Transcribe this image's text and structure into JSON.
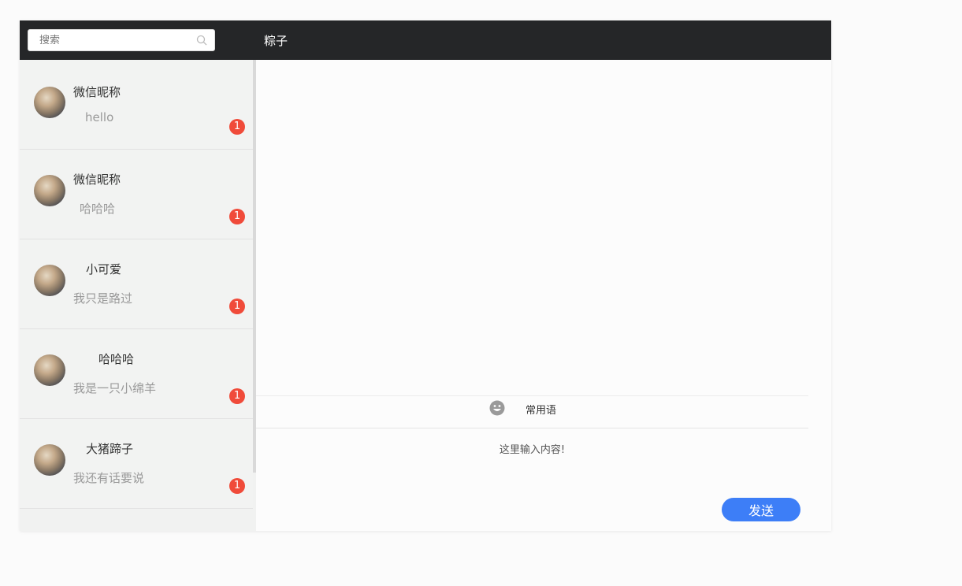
{
  "search": {
    "placeholder": "搜索",
    "icon": "search-icon"
  },
  "chat": {
    "title": "粽子"
  },
  "contacts": [
    {
      "name": "微信昵称",
      "last_message": "hello",
      "unread": "1"
    },
    {
      "name": "微信昵称",
      "last_message": "哈哈哈",
      "unread": "1"
    },
    {
      "name": "小可爱",
      "last_message": "我只是路过",
      "unread": "1"
    },
    {
      "name": "哈哈哈",
      "last_message": "我是一只小绵羊",
      "unread": "1"
    },
    {
      "name": "大猪蹄子",
      "last_message": "我还有话要说",
      "unread": "1"
    }
  ],
  "toolbar": {
    "emoji_icon": "smiley-icon",
    "phrases_label": "常用语"
  },
  "input": {
    "placeholder": "这里输入内容!"
  },
  "send": {
    "label": "发送"
  },
  "colors": {
    "topbar": "#252628",
    "badge": "#f04b3a",
    "send_button": "#3d7ef7"
  }
}
